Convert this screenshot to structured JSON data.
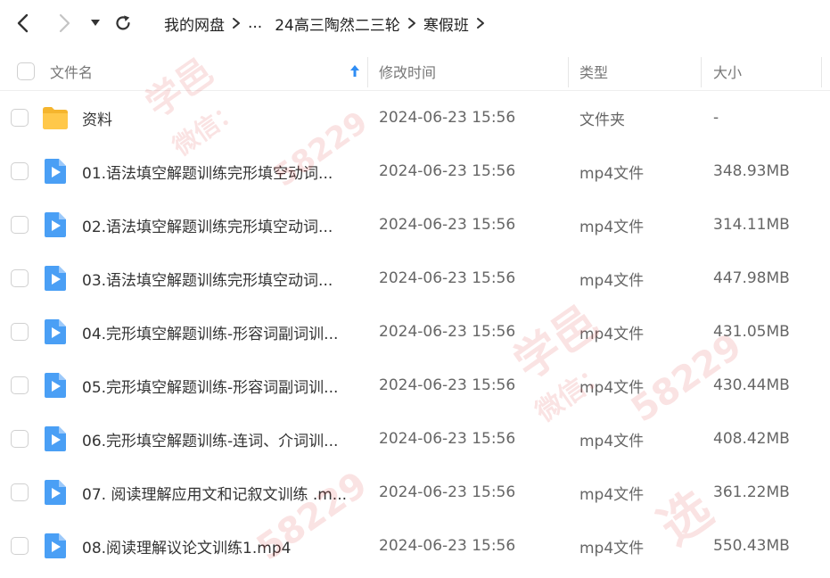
{
  "nav": {
    "breadcrumb": [
      "我的网盘",
      "...",
      "24高三陶然二三轮",
      "寒假班"
    ]
  },
  "table": {
    "columns": {
      "name": "文件名",
      "modified": "修改时间",
      "type": "类型",
      "size": "大小"
    },
    "rows": [
      {
        "name": "资料",
        "date": "2024-06-23 15:56",
        "type": "文件夹",
        "size": "-",
        "icon": "folder-icon"
      },
      {
        "name": "01.语法填空解题训练完形填空动词...",
        "date": "2024-06-23 15:56",
        "type": "mp4文件",
        "size": "348.93MB",
        "icon": "video-file-icon"
      },
      {
        "name": "02.语法填空解题训练完形填空动词...",
        "date": "2024-06-23 15:56",
        "type": "mp4文件",
        "size": "314.11MB",
        "icon": "video-file-icon"
      },
      {
        "name": "03.语法填空解题训练完形填空动词...",
        "date": "2024-06-23 15:56",
        "type": "mp4文件",
        "size": "447.98MB",
        "icon": "video-file-icon"
      },
      {
        "name": "04.完形填空解题训练-形容词副词训...",
        "date": "2024-06-23 15:56",
        "type": "mp4文件",
        "size": "431.05MB",
        "icon": "video-file-icon"
      },
      {
        "name": "05.完形填空解题训练-形容词副词训...",
        "date": "2024-06-23 15:56",
        "type": "mp4文件",
        "size": "430.44MB",
        "icon": "video-file-icon"
      },
      {
        "name": "06.完形填空解题训练-连词、介词训...",
        "date": "2024-06-23 15:56",
        "type": "mp4文件",
        "size": "408.42MB",
        "icon": "video-file-icon"
      },
      {
        "name": "07. 阅读理解应用文和记叙文训练 .m...",
        "date": "2024-06-23 15:56",
        "type": "mp4文件",
        "size": "361.22MB",
        "icon": "video-file-icon"
      },
      {
        "name": "08.阅读理解议论文训练1.mp4",
        "date": "2024-06-23 15:56",
        "type": "mp4文件",
        "size": "550.43MB",
        "icon": "video-file-icon"
      }
    ]
  },
  "watermark": {
    "texts": [
      "学邑",
      "微信：",
      "58229",
      "选"
    ]
  },
  "colors": {
    "accent": "#2f8df4",
    "folder": "#ffc53d",
    "video": "#4a9ff5"
  }
}
